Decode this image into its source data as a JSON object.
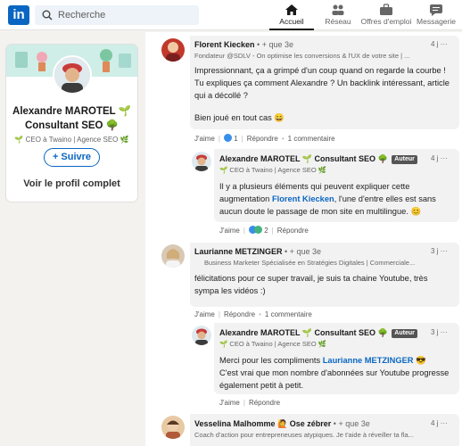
{
  "topbar": {
    "logo": "in",
    "search_placeholder": "Recherche",
    "nav": [
      {
        "label": "Accueil",
        "icon": "home-icon"
      },
      {
        "label": "Réseau",
        "icon": "network-icon"
      },
      {
        "label": "Offres d'emploi",
        "icon": "briefcase-icon"
      },
      {
        "label": "Messagerie",
        "icon": "messaging-icon"
      }
    ]
  },
  "profile": {
    "name": "Alexandre MAROTEL 🌱 Consultant SEO 🌳",
    "headline": "🌱 CEO à Twaino | Agence SEO 🌿",
    "follow": "+ Suivre",
    "view_profile": "Voir le profil complet"
  },
  "comments": [
    {
      "name": "Florent Kiecken",
      "degree": "• + que 3e",
      "headline": "Fondateur @SDLV - On optimise les conversions & l'UX de votre site | ...",
      "time": "4 j",
      "text": "Impressionnant, ça a grimpé d'un coup quand on regarde la courbe ! Tu expliques ça comment Alexandre ? Un backlink intéressant, article qui a décollé ?",
      "text2": "Bien joué en tout cas 😄",
      "like": "J'aime",
      "reactions": "1",
      "reply": "Répondre",
      "replies_count": "1 commentaire"
    },
    {
      "name": "Alexandre MAROTEL 🌱 Consultant SEO 🌳",
      "badge": "Auteur",
      "headline": "🌱 CEO à Twaino | Agence SEO 🌿",
      "time": "4 j",
      "text_a": "Il y a plusieurs éléments qui peuvent expliquer cette augmentation ",
      "mention": "Florent Kiecken",
      "text_b": ", l'une d'entre elles est sans aucun doute le passage de mon site en multilingue. 😊",
      "like": "J'aime",
      "reactions": "2",
      "reply": "Répondre"
    },
    {
      "name": "Laurianne METZINGER",
      "degree": "• + que 3e",
      "headline": "Business Marketer Spécialisée en Stratégies Digitales | Commerciale...",
      "time": "3 j",
      "text": "félicitations pour ce super travail, je suis ta chaine Youtube, très sympa les vidéos :)",
      "like": "J'aime",
      "reply": "Répondre",
      "replies_count": "1 commentaire"
    },
    {
      "name": "Alexandre MAROTEL 🌱 Consultant SEO 🌳",
      "badge": "Auteur",
      "headline": "🌱 CEO à Twaino | Agence SEO 🌿",
      "time": "3 j",
      "text_a": "Merci pour les compliments ",
      "mention": "Laurianne METZINGER",
      "text_b": " 😎",
      "text2": "C'est vrai que mon nombre d'abonnées sur Youtube progresse également petit à petit.",
      "like": "J'aime",
      "reply": "Répondre"
    },
    {
      "name": "Vesselina Malhomme 🙋 Ose zébrer",
      "degree": "• + que 3e",
      "headline": "Coach d'action pour entrepreneuses atypiques. Je t'aide à réveiller ta fla...",
      "time": "4 j"
    }
  ],
  "colors": {
    "brand": "#0a66c2",
    "bubble": "#f2f2f2",
    "page_bg": "#f3f2ef"
  }
}
